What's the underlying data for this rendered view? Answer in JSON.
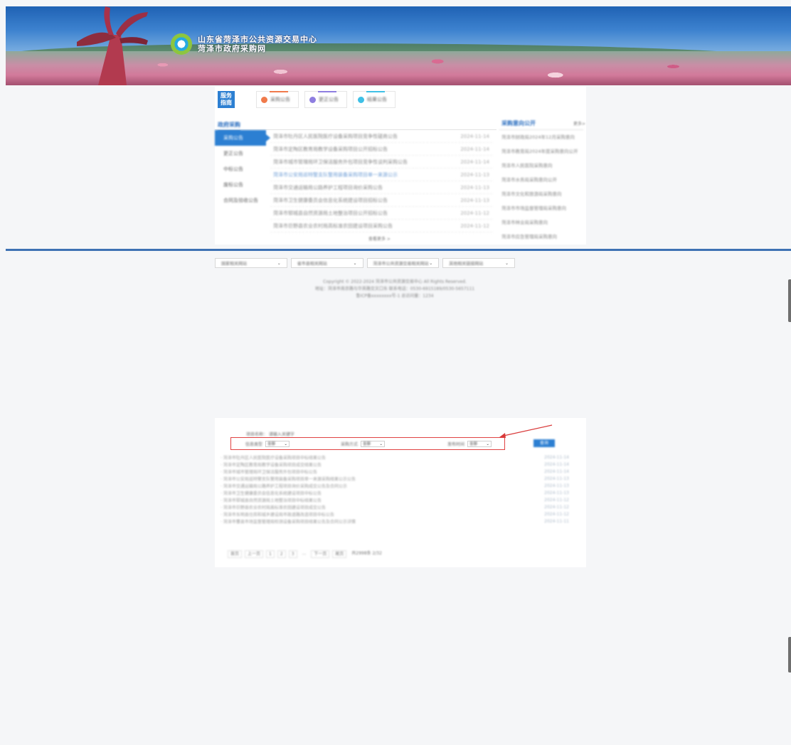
{
  "banner": {
    "title_line1": "山东省菏泽市公共资源交易中心",
    "title_line2": "菏泽市政府采购网"
  },
  "service_tabs": {
    "badge": "服务\n指南",
    "tabs": [
      {
        "label": "采购公告",
        "color": "#f07a4b"
      },
      {
        "label": "更正公告",
        "color": "#8e7ee0"
      },
      {
        "label": "结果公告",
        "color": "#3fc0e6"
      }
    ]
  },
  "notices": {
    "header": "政府采购",
    "categories": [
      "采购公告",
      "更正公告",
      "中标公告",
      "废标公告",
      "合同及验收公告"
    ],
    "rows": [
      {
        "title": "菏泽市牡丹区人民医院医疗设备采购项目竞争性磋商公告",
        "date": "2024-11-14"
      },
      {
        "title": "菏泽市定陶区教育局教学设备采购项目公开招标公告",
        "date": "2024-11-14"
      },
      {
        "title": "菏泽市城市管理局环卫保洁服务外包项目竞争性谈判采购公告",
        "date": "2024-11-14"
      },
      {
        "title": "菏泽市公安局巡特警支队警用装备采购项目单一来源公示",
        "date": "2024-11-13"
      },
      {
        "title": "菏泽市交通运输局公路养护工程项目询价采购公告",
        "date": "2024-11-13"
      },
      {
        "title": "菏泽市卫生健康委员会信息化系统建设项目招标公告",
        "date": "2024-11-13"
      },
      {
        "title": "菏泽市郓城县自然资源局土地整治项目公开招标公告",
        "date": "2024-11-12"
      },
      {
        "title": "菏泽市巨野县农业农村局高标准农田建设项目采购公告",
        "date": "2024-11-12"
      }
    ],
    "more": "查看更多 >"
  },
  "side_notices": {
    "header": "采购意向公开",
    "more": "更多>",
    "rows": [
      "菏泽市财政局2024年12月采购意向",
      "菏泽市教育局2024年度采购意向公开",
      "菏泽市人民医院采购意向",
      "菏泽市水务局采购意向公开",
      "菏泽市文化和旅游局采购意向",
      "菏泽市市场监督管理局采购意向",
      "菏泽市林业局采购意向",
      "菏泽市应急管理局采购意向"
    ]
  },
  "links": [
    {
      "label": "国家相关网站"
    },
    {
      "label": "省市县相关网站"
    },
    {
      "label": "菏泽市公共资源交易相关网站"
    },
    {
      "label": "其他相关链接网站"
    }
  ],
  "footer": {
    "line1": "Copyright © 2022-2024 菏泽市公共资源交易中心 All Rights Reserved.",
    "line2": "地址：菏泽市南京路与华英路交叉口东    联系电话：0530-6915189/0530-5657111",
    "line3": "鲁ICP备xxxxxxxx号-1  总访问量：1234"
  },
  "results": {
    "filter_title": "项目名称：  请输入关键字",
    "filter_box": {
      "f1_label": "信息类型",
      "f1_value": "全部",
      "f2_label": "采购方式",
      "f2_value": "全部",
      "f3_label": "发布时间",
      "f3_value": "全部"
    },
    "query_btn": "查询",
    "rows": [
      {
        "title": "· 菏泽市牡丹区人民医院医疗设备采购项目中标结果公告",
        "date": "2024-11-14"
      },
      {
        "title": "· 菏泽市定陶区教育局教学设备采购项目成交结果公告",
        "date": "2024-11-14"
      },
      {
        "title": "· 菏泽市城市管理局环卫保洁服务外包项目中标公告",
        "date": "2024-11-14"
      },
      {
        "title": "· 菏泽市公安局巡特警支队警用装备采购项目单一来源采购结果公示公告",
        "date": "2024-11-13"
      },
      {
        "title": "· 菏泽市交通运输局公路养护工程项目询价采购成交公告及合同公示",
        "date": "2024-11-13"
      },
      {
        "title": "· 菏泽市卫生健康委员会信息化系统建设项目中标公告",
        "date": "2024-11-13"
      },
      {
        "title": "· 菏泽市郓城县自然资源局土地整治项目中标结果公告",
        "date": "2024-11-12"
      },
      {
        "title": "· 菏泽市巨野县农业农村局高标准农田建设项目成交公告",
        "date": "2024-11-12"
      },
      {
        "title": "· 菏泽市东明县住房和城乡建设局市政道路改造项目中标公告",
        "date": "2024-11-12"
      },
      {
        "title": "· 菏泽市曹县市场监督管理局检测设备采购项目结果公告及合同公示详情",
        "date": "2024-11-11"
      }
    ],
    "pager": {
      "first": "首页",
      "prev": "上一页",
      "p1": "1",
      "p2": "2",
      "p3": "3",
      "ellipsis": "...",
      "next": "下一页",
      "last": "尾页",
      "total": "共2998条 2/32"
    }
  },
  "colors": {
    "primary": "#2c7fd2",
    "divider": "#3e72b4",
    "highlight_box": "#e04242"
  }
}
